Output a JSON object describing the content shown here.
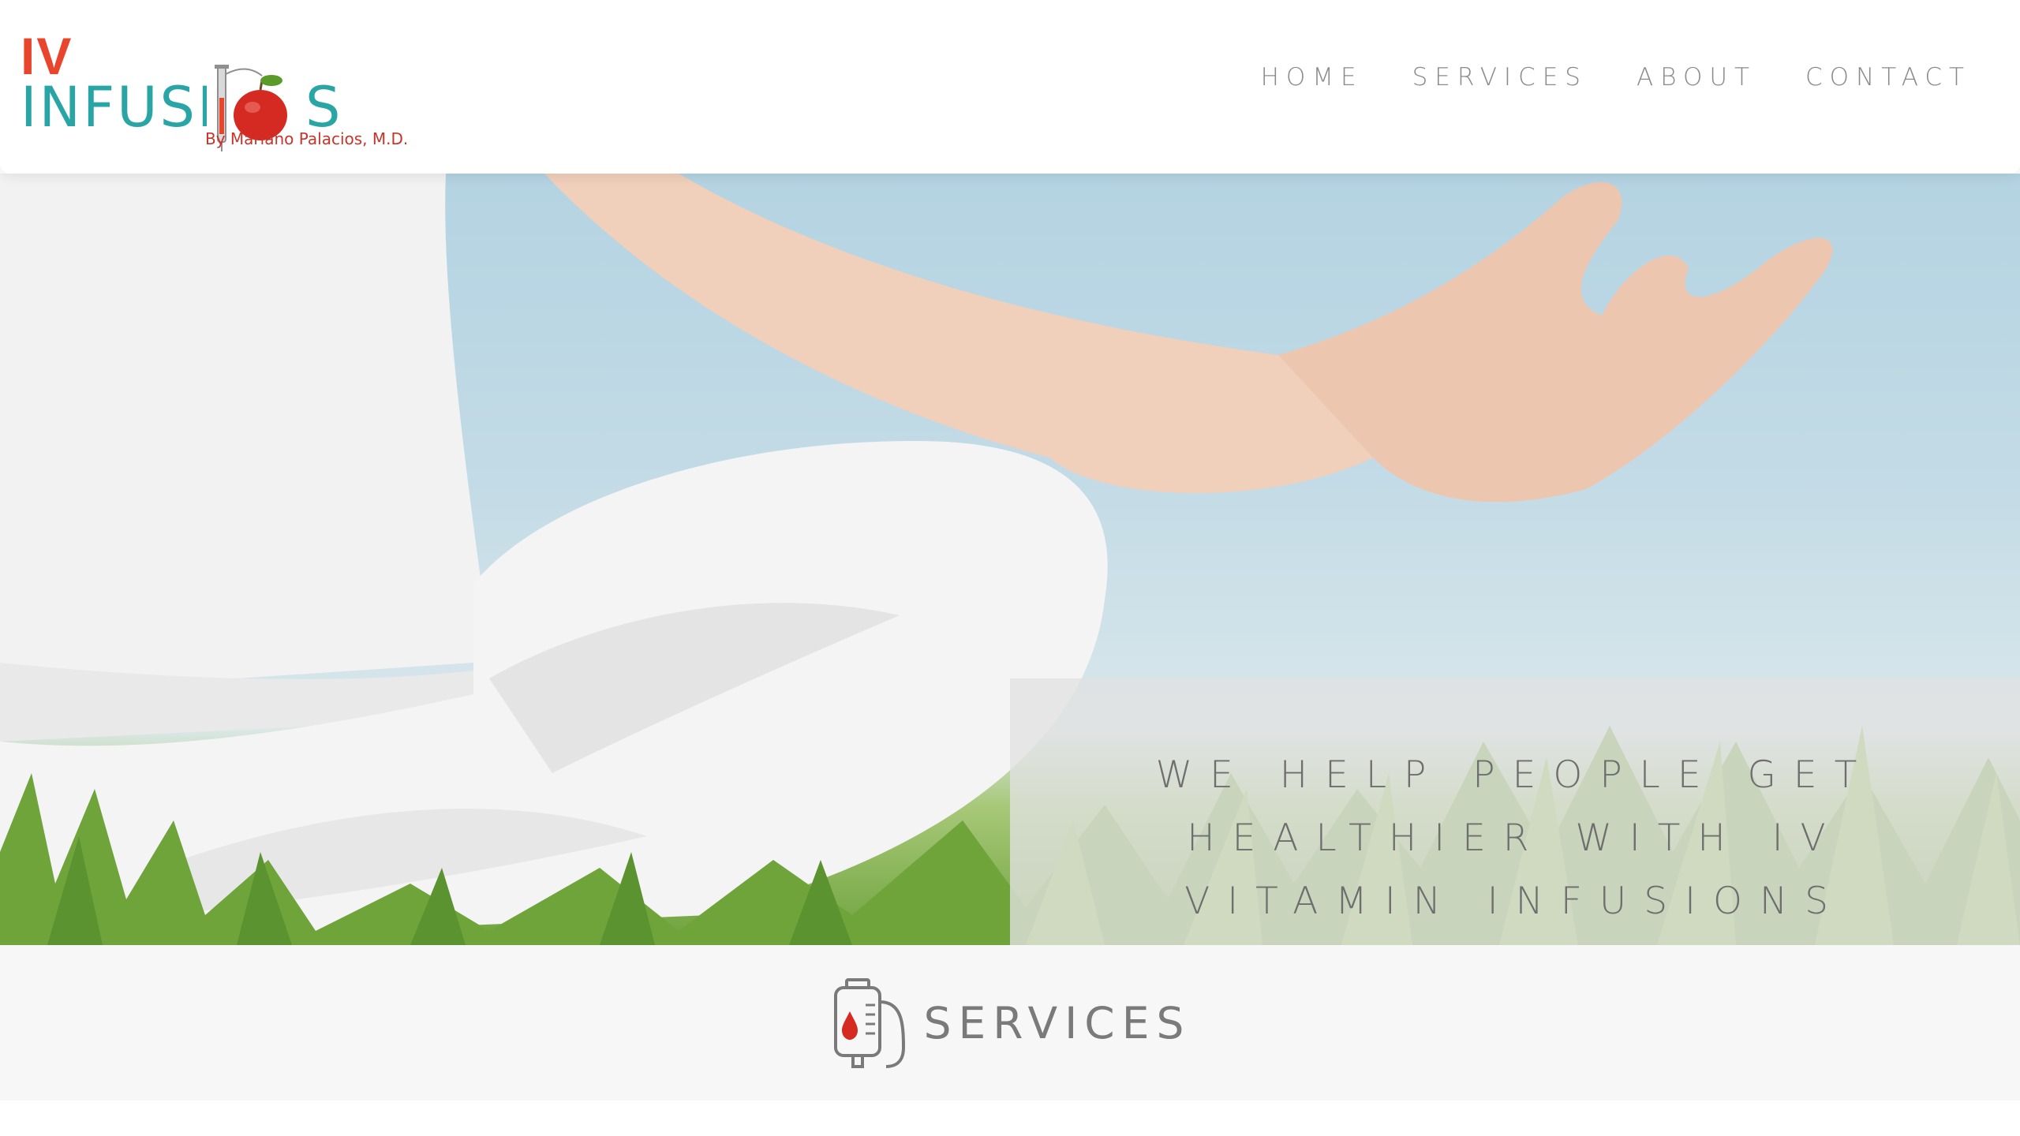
{
  "brand": {
    "logo_line1": "IV",
    "logo_line2": "INFUSIONS",
    "logo_byline": "By Mariano Palacios, M.D.",
    "colors": {
      "red": "#e8452c",
      "teal": "#2aa5a5",
      "byline": "#c8332a"
    }
  },
  "nav": {
    "items": [
      {
        "label": "HOME"
      },
      {
        "label": "SERVICES"
      },
      {
        "label": "ABOUT"
      },
      {
        "label": "CONTACT"
      }
    ]
  },
  "hero": {
    "tagline": "WE HELP PEOPLE GET HEALTHIER WITH IV VITAMIN INFUSIONS",
    "image_icon": "meditation-photo"
  },
  "services": {
    "title": "SERVICES",
    "icon": "iv-bag-icon"
  }
}
